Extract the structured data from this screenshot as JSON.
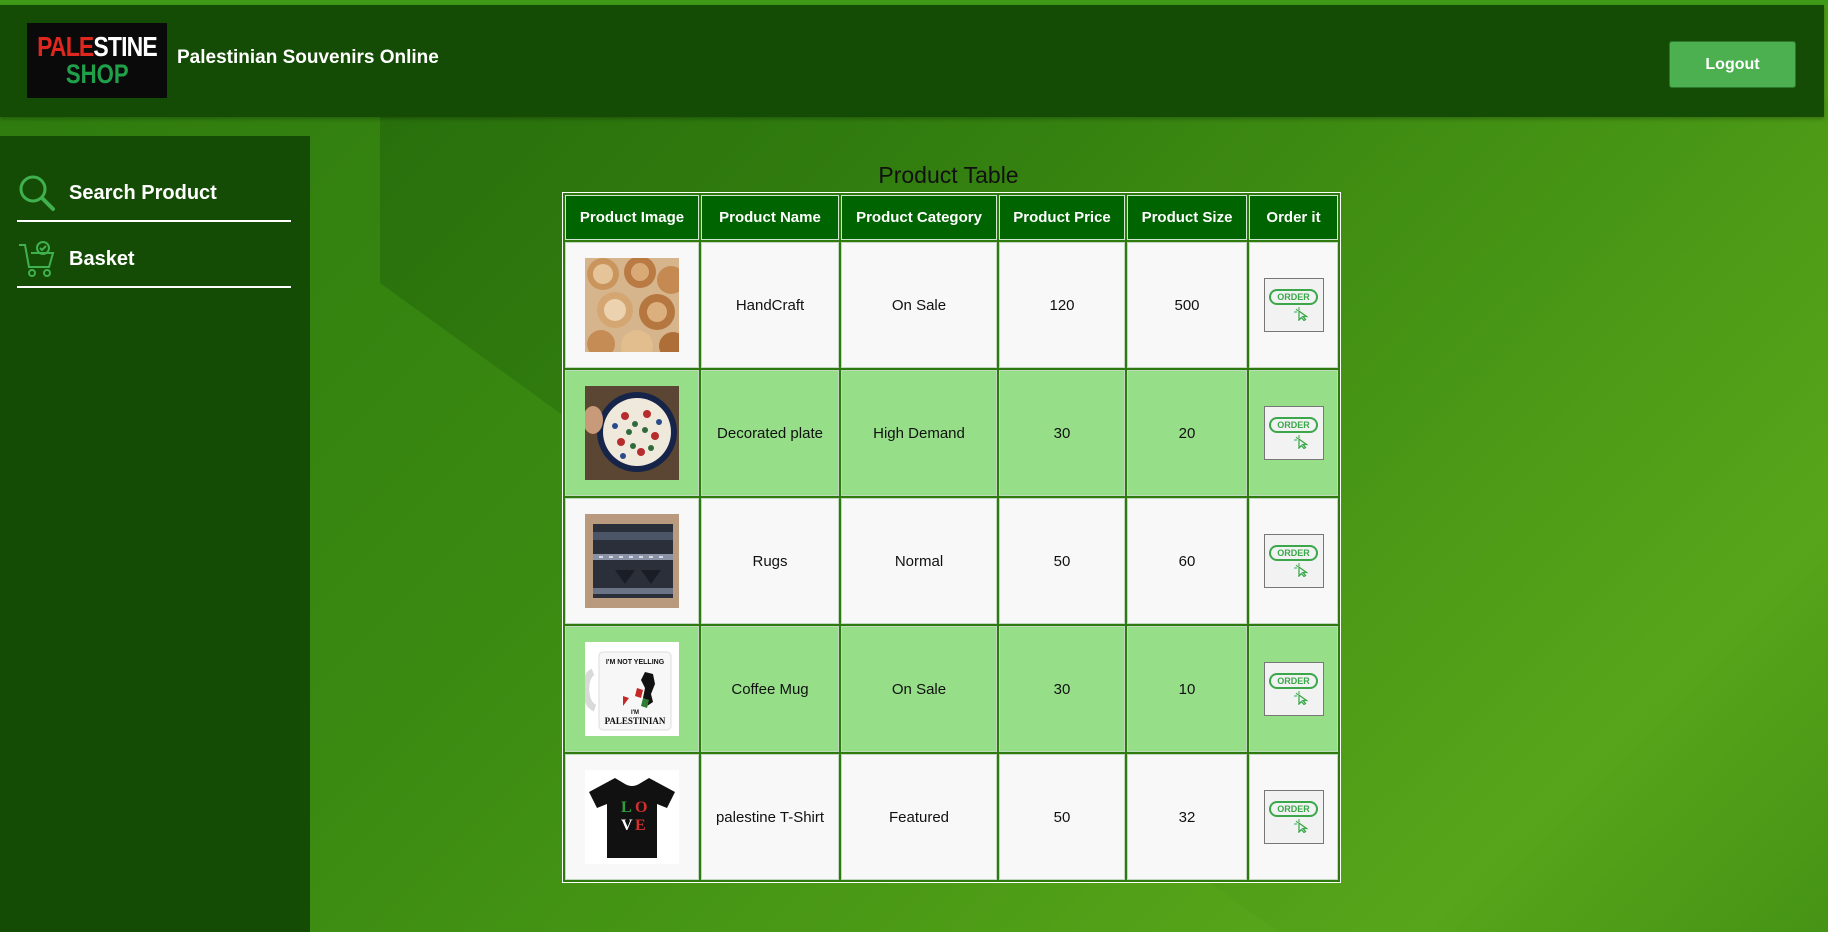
{
  "header": {
    "logo": {
      "line1_red": "PALE",
      "line1_white": "STINE",
      "line2": "SHOP"
    },
    "title": "Palestinian Souvenirs Online",
    "logout_label": "Logout"
  },
  "sidebar": {
    "items": [
      {
        "label": "Search Product",
        "icon": "search-icon"
      },
      {
        "label": "Basket",
        "icon": "cart-icon"
      }
    ]
  },
  "table": {
    "title": "Product Table",
    "columns": [
      "Product Image",
      "Product Name",
      "Product Category",
      "Product Price",
      "Product Size",
      "Order it"
    ],
    "rows": [
      {
        "name": "HandCraft",
        "category": "On Sale",
        "price": "120",
        "size": "500",
        "image": "wooden-bowls-image"
      },
      {
        "name": "Decorated plate",
        "category": "High Demand",
        "price": "30",
        "size": "20",
        "image": "decorated-plate-image"
      },
      {
        "name": "Rugs",
        "category": "Normal",
        "price": "50",
        "size": "60",
        "image": "rug-image"
      },
      {
        "name": "Coffee Mug",
        "category": "On Sale",
        "price": "30",
        "size": "10",
        "image": "coffee-mug-image"
      },
      {
        "name": "palestine T-Shirt",
        "category": "Featured",
        "price": "50",
        "size": "32",
        "image": "tshirt-image"
      }
    ],
    "order_button_label": "ORDER",
    "mug_text": {
      "top": "I'M NOT YELLING",
      "bottom1": "I'M",
      "bottom2": "PALESTINIAN"
    },
    "shirt_text": {
      "l1": "L",
      "o": "O",
      "v": "V",
      "e": "E"
    }
  },
  "colors": {
    "header_bg": "#154c05",
    "header_cell": "#006400",
    "row_alt": "#96de88",
    "button_green": "#4caf50"
  }
}
